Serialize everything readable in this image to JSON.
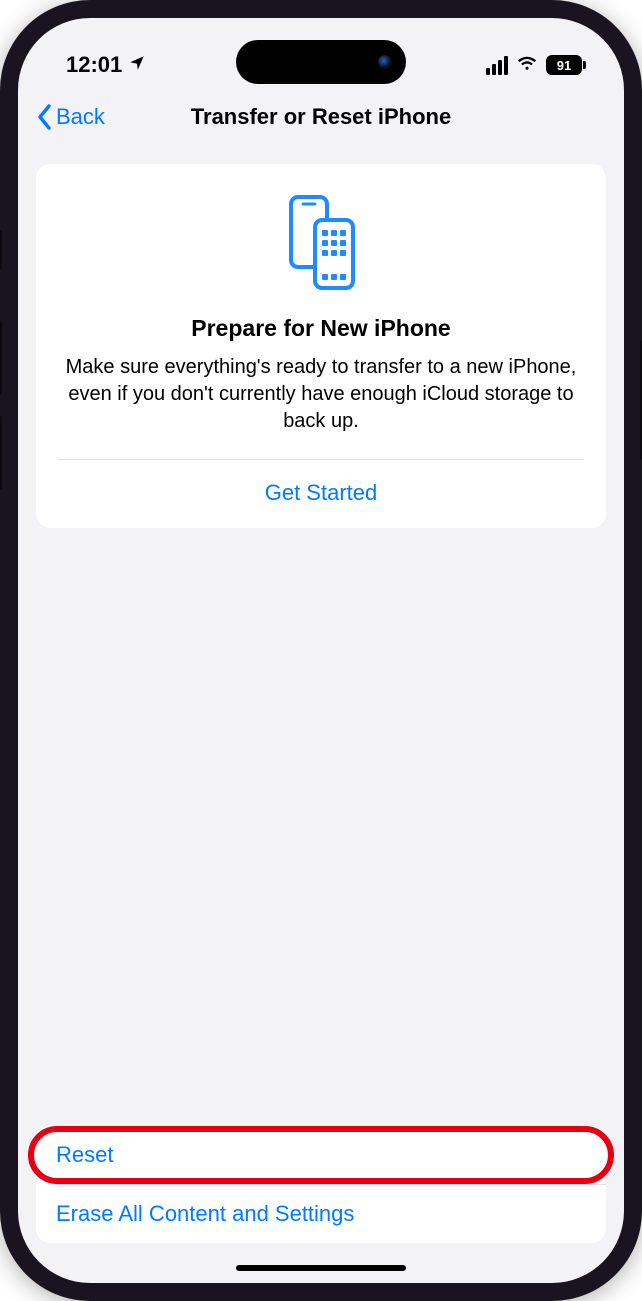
{
  "status": {
    "time": "12:01",
    "battery_percent": "91"
  },
  "nav": {
    "back_label": "Back",
    "title": "Transfer or Reset iPhone"
  },
  "card": {
    "title": "Prepare for New iPhone",
    "description": "Make sure everything's ready to transfer to a new iPhone, even if you don't currently have enough iCloud storage to back up.",
    "action_label": "Get Started"
  },
  "bottom": {
    "reset_label": "Reset",
    "erase_label": "Erase All Content and Settings"
  }
}
